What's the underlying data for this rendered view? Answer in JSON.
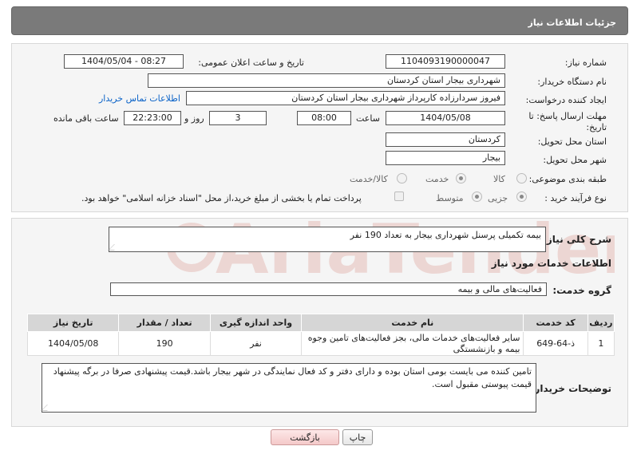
{
  "header": {
    "title": "جزئیات اطلاعات نیاز"
  },
  "form": {
    "need_number_label": "شماره نیاز:",
    "need_number": "1104093190000047",
    "announce_label": "تاریخ و ساعت اعلان عمومی:",
    "announce_value": "1404/05/04 - 08:27",
    "buyer_org_label": "نام دستگاه خریدار:",
    "buyer_org": "شهرداری بیجار استان کردستان",
    "requester_label": "ایجاد کننده درخواست:",
    "requester": "فیروز  سردارزاده کارپرداز  شهرداری بیجار استان کردستان",
    "contact_link": "اطلاعات تماس خریدار",
    "deadline_label": "مهلت ارسال پاسخ: تا تاریخ:",
    "deadline_date": "1404/05/08",
    "time_label": "ساعت",
    "deadline_time": "08:00",
    "days_value": "3",
    "days_label": "روز و",
    "remaining_time": "22:23:00",
    "remaining_label": "ساعت باقی مانده",
    "province_label": "استان محل تحویل:",
    "province": "کردستان",
    "city_label": "شهر محل تحویل:",
    "city": "بیجار",
    "category_label": "طبقه بندی موضوعی:",
    "category_options": [
      "کالا",
      "خدمت",
      "کالا/خدمت"
    ],
    "category_selected": "خدمت",
    "purchase_type_label": "نوع فرآیند خرید :",
    "purchase_options": [
      "جزیی",
      "متوسط"
    ],
    "purchase_selected": "جزیی",
    "payment_note": "پرداخت تمام یا بخشی از مبلغ خرید،از محل \"اسناد خزانه اسلامی\" خواهد بود."
  },
  "details": {
    "summary_label": "شرح کلی نیاز:",
    "summary": "بیمه تکمیلی پرسنل شهرداری بیجار به تعداد 190 نفر",
    "services_heading": "اطلاعات خدمات مورد نیاز",
    "service_group_label": "گروه خدمت:",
    "service_group": "فعالیت‌های مالی و بیمه",
    "table": {
      "headers": [
        "ردیف",
        "کد خدمت",
        "نام خدمت",
        "واحد اندازه گیری",
        "تعداد / مقدار",
        "تاریخ نیاز"
      ],
      "rows": [
        [
          "1",
          "ذ-64-649",
          "سایر فعالیت‌های خدمات مالی، بجز فعالیت‌های تامین وجوه بیمه و بازنشستگی",
          "نفر",
          "190",
          "1404/05/08"
        ]
      ]
    },
    "buyer_notes_label": "توضیحات خریدار:",
    "buyer_notes": "تامین کننده می بایست بومی استان بوده و دارای دفتر و کد فعال نمایندگی در شهر بیجار باشد.قیمت پیشنهادی صرفا در برگه پیشنهاد قیمت پیوستی مقبول است."
  },
  "buttons": {
    "print": "چاپ",
    "back": "بازگشت"
  },
  "watermark": {
    "text": "AriaTender.neT"
  },
  "colors": {
    "header_bg": "#7a7a7a",
    "link": "#0b63c8",
    "watermark": "#c0392b"
  }
}
